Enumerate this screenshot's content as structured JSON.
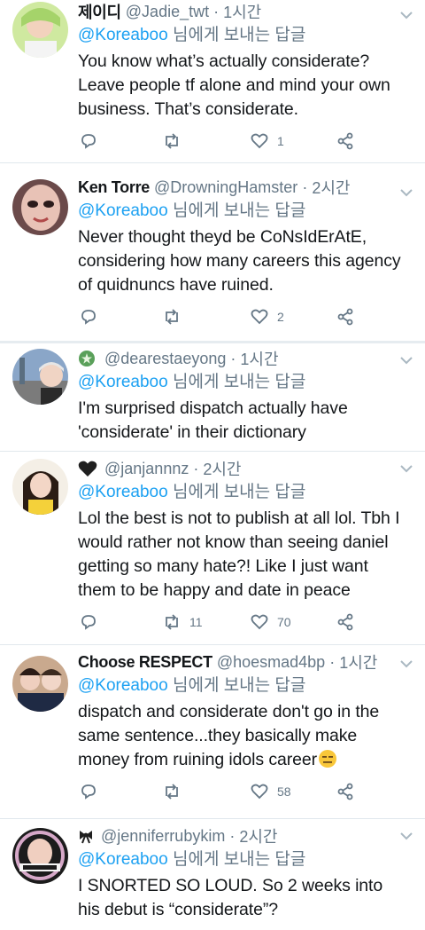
{
  "tweets": [
    {
      "badge": "",
      "name": "제이디",
      "handle": "@Jadie_twt",
      "sep": "·",
      "time": "1시간",
      "reply_to": "@Koreaboo",
      "reply_suffix": " 님에게 보내는 답글",
      "text": "You know what’s actually considerate? Leave people tf alone and mind your own business. That’s considerate.",
      "retweets": "",
      "likes": "1"
    },
    {
      "badge": "",
      "name": "Ken Torre",
      "handle": "@DrowningHamster",
      "sep": "·",
      "time": "2시간",
      "reply_to": "@Koreaboo",
      "reply_suffix": " 님에게 보내는 답글",
      "text": "Never thought theyd be CoNsIdErAtE, considering how many careers this agency of quidnuncs have ruined.",
      "retweets": "",
      "likes": "2"
    },
    {
      "badge": "green-circle-emoji",
      "name": "",
      "handle": "@dearestaeyong",
      "sep": "·",
      "time": "1시간",
      "reply_to": "@Koreaboo",
      "reply_suffix": " 님에게 보내는 답글",
      "text": "I'm surprised dispatch actually have 'considerate' in their dictionary"
    },
    {
      "badge": "black-heart-emoji",
      "name": "",
      "handle": "@janjannnz",
      "sep": "·",
      "time": "2시간",
      "reply_to": "@Koreaboo",
      "reply_suffix": " 님에게 보내는 답글",
      "text": "Lol the best is not to publish at all lol. Tbh I would rather not know than seeing daniel getting so many hate?! Like I just want them to be happy and date in peace",
      "retweets": "11",
      "likes": "70"
    },
    {
      "badge": "",
      "name": "Choose RESPECT",
      "handle": "@hoesmad4bp",
      "sep": "·",
      "time": "1시간",
      "reply_to": "@Koreaboo",
      "reply_suffix": " 님에게 보내는 답글",
      "text": "dispatch and considerate don't go in the same sentence...they basically make money from ruining idols career",
      "emoji": "expressionless-face-emoji",
      "retweets": "",
      "likes": "58"
    },
    {
      "badge": "bow-emoji",
      "name": "",
      "handle": "@jenniferrubykim",
      "sep": "·",
      "time": "2시간",
      "reply_to": "@Koreaboo",
      "reply_suffix": " 님에게 보내는 답글",
      "text": "I SNORTED SO LOUD. So 2 weeks into his debut is “considerate”?"
    }
  ],
  "colors": {
    "link": "#1da1f2",
    "muted": "#657786",
    "text": "#14171a"
  },
  "icons": {
    "reply": "reply-icon",
    "retweet": "retweet-icon",
    "like": "heart-icon",
    "share": "share-icon",
    "menu": "chevron-down-icon"
  }
}
